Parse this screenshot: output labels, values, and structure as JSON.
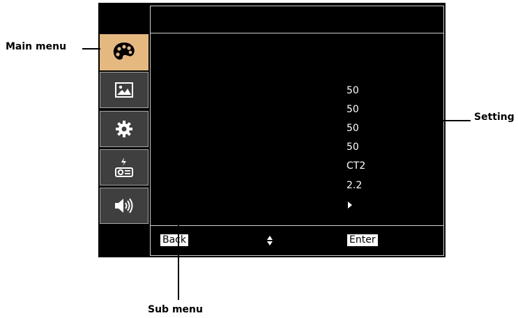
{
  "osd": {
    "main_menu_tabs": [
      {
        "icon": "palette-icon",
        "active": true
      },
      {
        "icon": "image-icon",
        "active": false
      },
      {
        "icon": "gear-icon",
        "active": false
      },
      {
        "icon": "projector-power-icon",
        "active": false
      },
      {
        "icon": "speaker-icon",
        "active": false
      }
    ],
    "setting_values": [
      "50",
      "50",
      "50",
      "50",
      "CT2",
      "2.2"
    ],
    "footer": {
      "back_label": "Back",
      "nav_icon": "up-down-arrows-icon",
      "enter_label": "Enter"
    }
  },
  "callouts": {
    "main_menu": "Main menu",
    "setting": "Setting",
    "sub_menu": "Sub menu"
  },
  "colors": {
    "active_tab": "#e5b880",
    "inactive_tab": "#3f3f3f",
    "osd_background": "#000000"
  }
}
